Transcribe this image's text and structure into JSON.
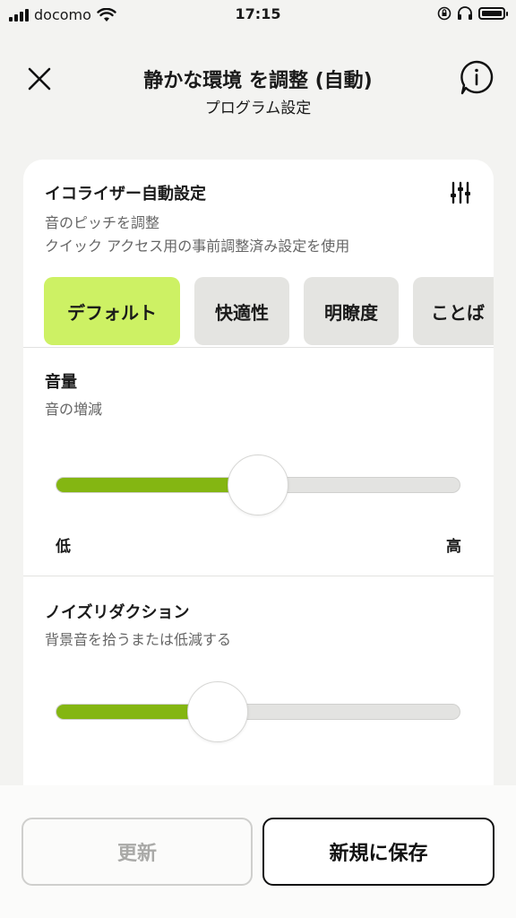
{
  "status_bar": {
    "carrier": "docomo",
    "time": "17:15",
    "wifi_icon": "wifi-icon",
    "battery_icon": "battery-icon"
  },
  "header": {
    "title": "静かな環境 を調整 (自動)",
    "subtitle": "プログラム設定",
    "close_icon": "close-icon",
    "info_icon": "info-icon"
  },
  "equalizer": {
    "title": "イコライザー自動設定",
    "description_line1": "音のピッチを調整",
    "description_line2": "クイック アクセス用の事前調整済み設定を使用",
    "settings_icon": "sliders-icon",
    "presets": [
      {
        "label": "デフォルト",
        "selected": true
      },
      {
        "label": "快適性",
        "selected": false
      },
      {
        "label": "明瞭度",
        "selected": false
      },
      {
        "label": "ことば",
        "selected": false
      }
    ],
    "accent_color": "#cdf164"
  },
  "volume": {
    "title": "音量",
    "description": "音の増減",
    "level": 0.5,
    "min_label": "低",
    "max_label": "高",
    "fill_color": "#84b612"
  },
  "noise_reduction": {
    "title": "ノイズリダクション",
    "description": "背景音を拾うまたは低減する",
    "level": 0.4
  },
  "actions": {
    "update_label": "更新",
    "save_new_label": "新規に保存"
  }
}
